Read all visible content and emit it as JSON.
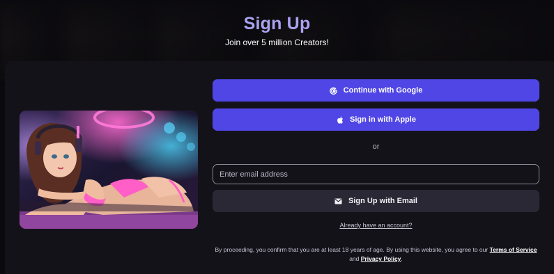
{
  "header": {
    "title": "Sign Up",
    "subtitle": "Join over 5 million Creators!"
  },
  "auth": {
    "google_label": "Continue with Google",
    "apple_label": "Sign in with Apple",
    "or_label": "or",
    "email_placeholder": "Enter email address",
    "email_value": "",
    "email_button_label": "Sign Up with Email",
    "login_link": "Already have an account?"
  },
  "legal": {
    "prefix": "By proceeding, you confirm that you are at least 18 years of age. By using this website, you agree to our",
    "terms_label": "Terms of Service",
    "and": "and",
    "privacy_label": "Privacy Policy",
    "suffix": "."
  },
  "colors": {
    "accent": "#5046e5",
    "title": "#a9a2ef",
    "card_bg": "#141219",
    "secondary_button": "#2a2834"
  },
  "icons": {
    "google": "google-g-icon",
    "apple": "apple-icon",
    "email": "envelope-icon"
  }
}
